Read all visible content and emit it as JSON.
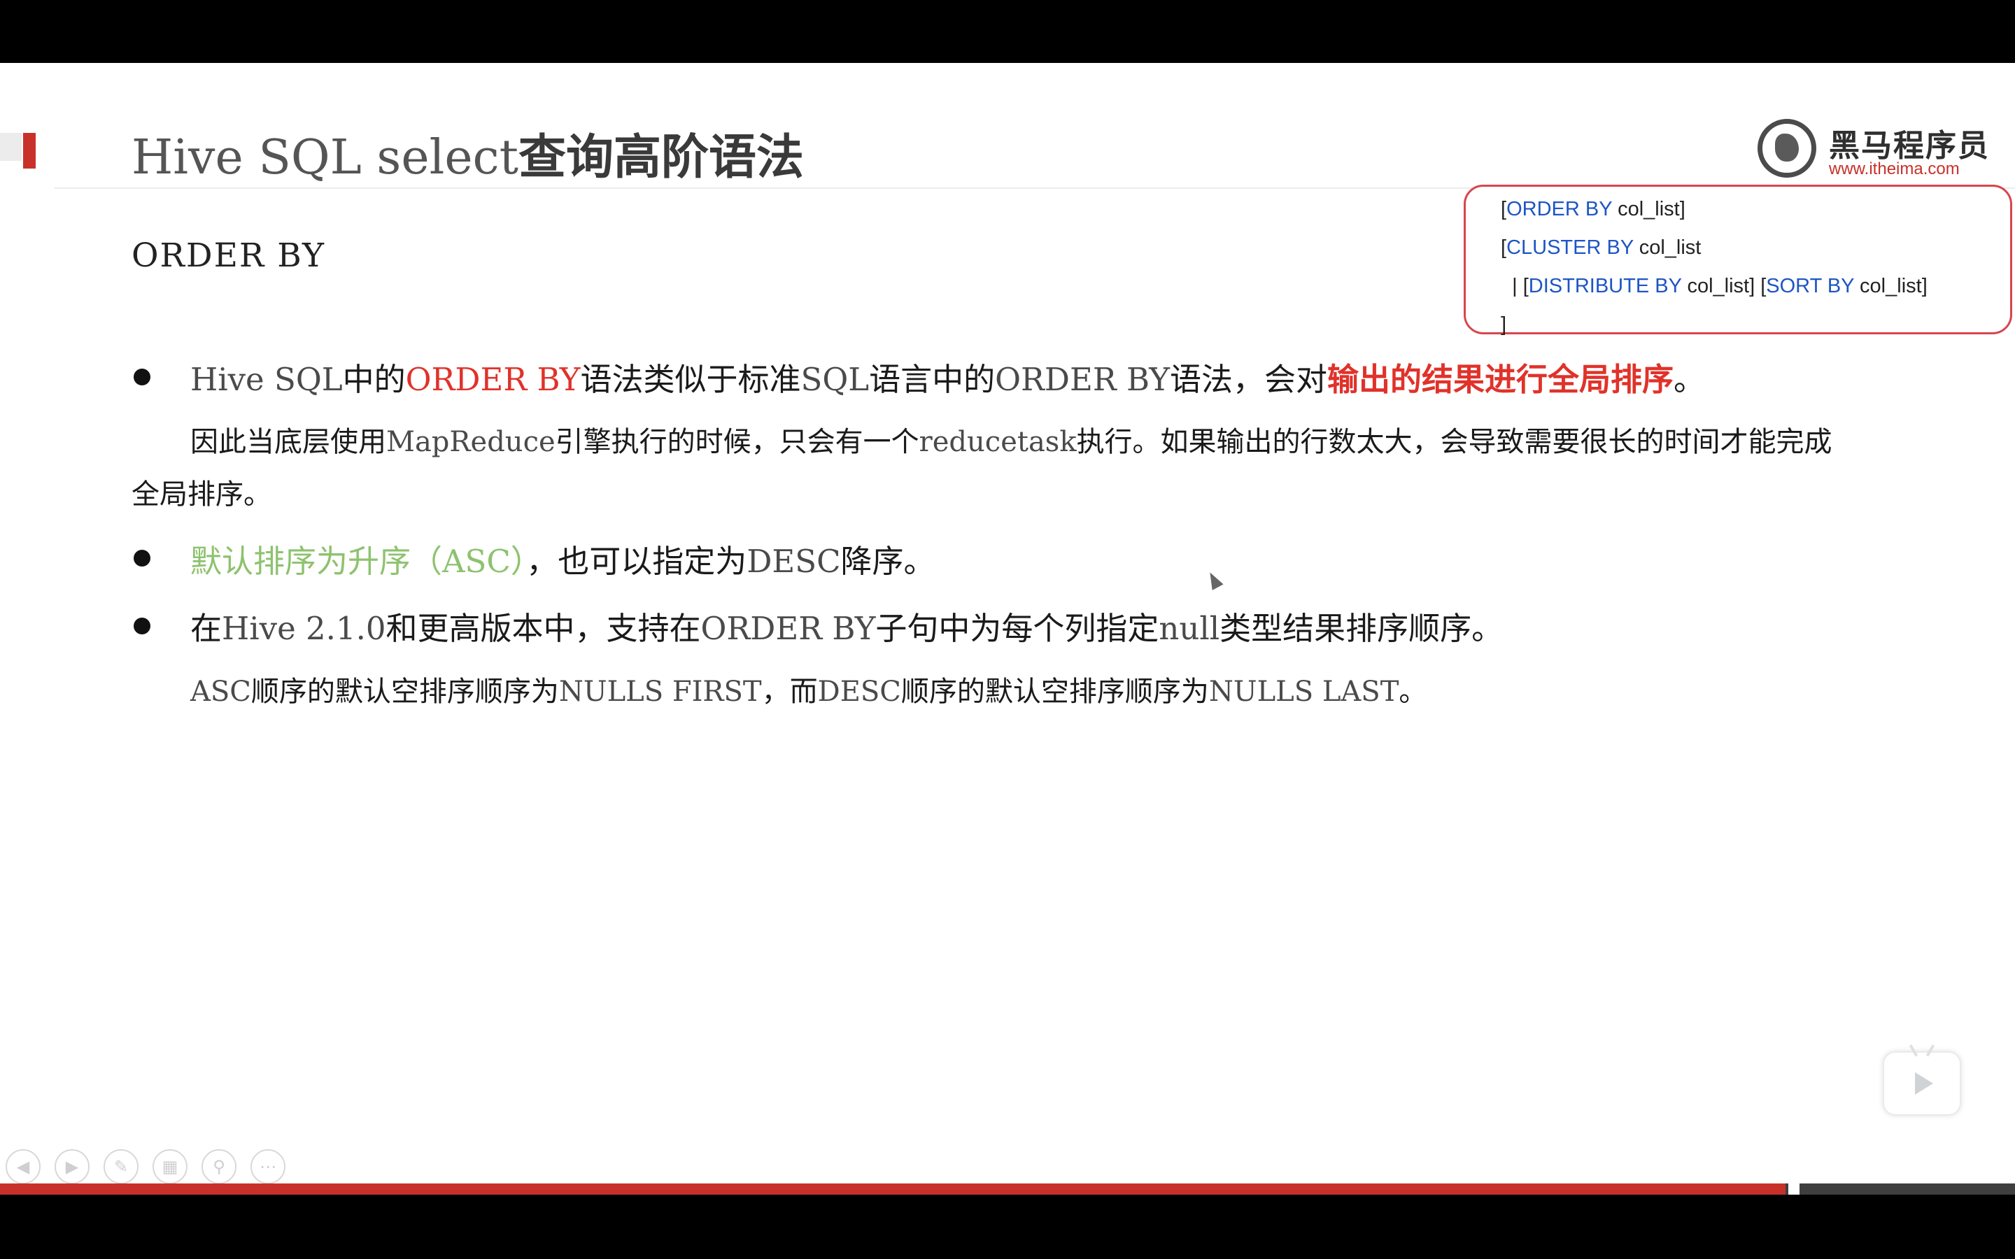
{
  "slide": {
    "title_latin": "Hive SQL select",
    "title_cjk": "查询高阶语法",
    "logo": {
      "name": "黑马程序员",
      "url": "www.itheima.com"
    },
    "syntax_box": {
      "line1": {
        "open": "[",
        "kw": "ORDER BY",
        "rest": " col_list]"
      },
      "line2": {
        "open": "[",
        "kw": "CLUSTER BY",
        "rest": " col_list"
      },
      "line3": {
        "pre": "  | [",
        "kw1": "DISTRIBUTE BY",
        "mid": " col_list] [",
        "kw2": "SORT BY",
        "rest": " col_list]"
      },
      "line4": "]"
    },
    "section_heading": "ORDER BY",
    "bullet1": {
      "p1": "Hive SQL",
      "p2": "中的",
      "p3": "ORDER BY",
      "p4": "语法类似于标准",
      "p5": "SQL",
      "p6": "语言中的",
      "p7": "ORDER BY",
      "p8": "语法，会对",
      "p9": "输出的结果进行全局排序",
      "p10": "。",
      "sub_a": "因此当底层使用",
      "sub_b": "MapReduce",
      "sub_c": "引擎执行的时候，只会有一个",
      "sub_d": "reducetask",
      "sub_e": "执行。如果输出的行数太大，会导致需要很长的时间才能完成",
      "sub_f": "全局排序。"
    },
    "bullet2": {
      "p1": "默认排序为升序（",
      "p2": "ASC",
      "p3": "）",
      "p4": "，也可以指定为",
      "p5": "DESC",
      "p6": "降序。"
    },
    "bullet3": {
      "p1": "在",
      "p2": "Hive 2.1.0",
      "p3": "和更高版本中，支持在",
      "p4": "ORDER BY",
      "p5": "子句中为每个列指定",
      "p6": "null",
      "p7": "类型结果排序顺序。",
      "sub_a": "ASC",
      "sub_b": "顺序的默认空排序顺序为",
      "sub_c": "NULLS FIRST",
      "sub_d": "，而",
      "sub_e": "DESC",
      "sub_f": "顺序的默认空排序顺序为",
      "sub_g": "NULLS LAST",
      "sub_h": "。"
    },
    "colors": {
      "accent_red": "#c8312a",
      "highlight_red": "#e0322a",
      "keyword_blue": "#1e55c4",
      "highlight_green": "#8dc26e"
    }
  },
  "player": {
    "progress_fraction": 0.886,
    "nav_icons": [
      "prev-icon",
      "next-icon",
      "pen-icon",
      "slides-icon",
      "zoom-icon",
      "more-icon"
    ]
  }
}
